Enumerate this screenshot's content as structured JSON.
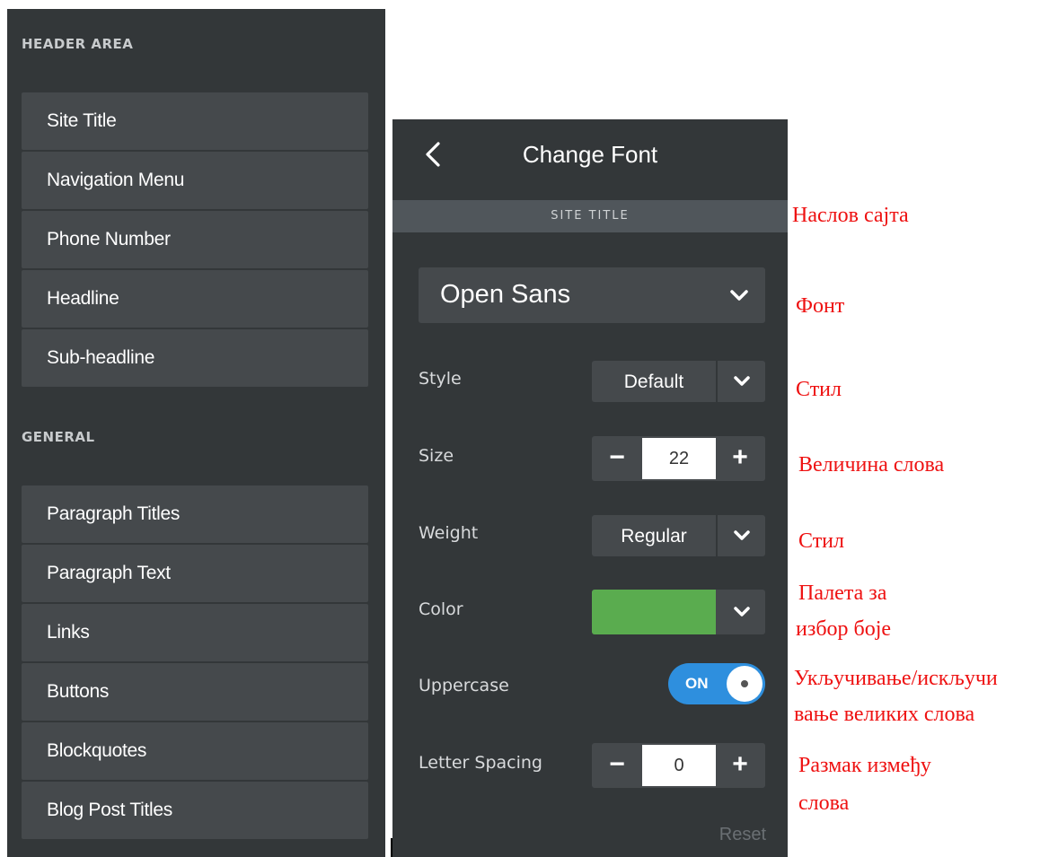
{
  "sidebar": {
    "header_area_title": "HEADER AREA",
    "header_items": [
      "Site Title",
      "Navigation Menu",
      "Phone Number",
      "Headline",
      "Sub-headline"
    ],
    "general_title": "GENERAL",
    "general_items": [
      "Paragraph Titles",
      "Paragraph Text",
      "Links",
      "Buttons",
      "Blockquotes",
      "Blog Post Titles"
    ]
  },
  "panel": {
    "back_icon": "chevron-left-icon",
    "title": "Change Font",
    "section": "SITE TITLE",
    "font": "Open Sans",
    "style_label": "Style",
    "style_value": "Default",
    "size_label": "Size",
    "size_value": "22",
    "weight_label": "Weight",
    "weight_value": "Regular",
    "color_label": "Color",
    "color_value": "#5aac4f",
    "uppercase_label": "Uppercase",
    "uppercase_toggle": "ON",
    "letter_spacing_label": "Letter Spacing",
    "letter_spacing_value": "0",
    "minus": "−",
    "plus": "+",
    "reset": "Reset"
  },
  "annotations": {
    "site_title": "Наслов сајта",
    "font": "Фонт",
    "style": "Стил",
    "size": "Величина слова",
    "weight": "Стил",
    "color_1": "Палета за",
    "color_2": "избор боје",
    "uppercase_1": "Укључивање/искључи",
    "uppercase_2": "вање великих слова",
    "spacing_1": "Размак између",
    "spacing_2": "слова"
  }
}
